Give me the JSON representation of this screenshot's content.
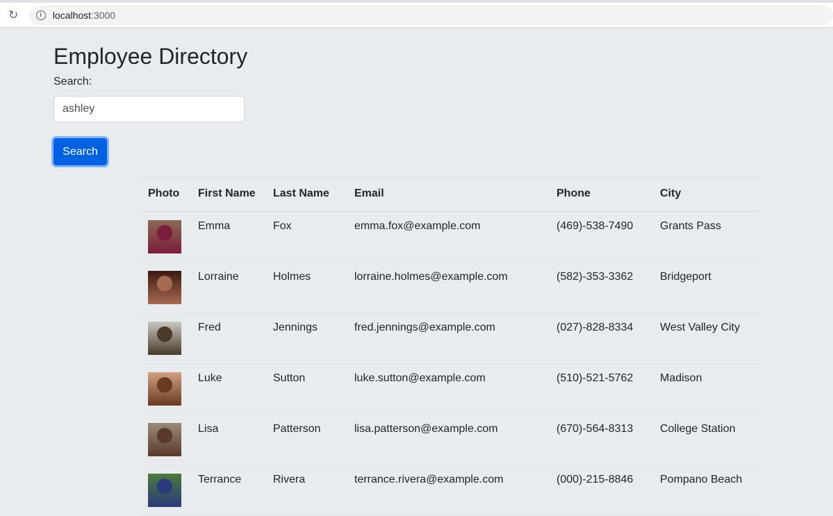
{
  "browser": {
    "host": "localhost",
    "port": ":3000"
  },
  "page": {
    "title": "Employee Directory",
    "search_label": "Search:",
    "search_value": "ashley",
    "search_button": "Search"
  },
  "table": {
    "headers": [
      "Photo",
      "First Name",
      "Last Name",
      "Email",
      "Phone",
      "City"
    ],
    "rows": [
      {
        "first": "Emma",
        "last": "Fox",
        "email": "emma.fox@example.com",
        "phone": "(469)-538-7490",
        "city": "Grants Pass",
        "photo_colors": [
          "#8a6a55",
          "#7a1d3a"
        ]
      },
      {
        "first": "Lorraine",
        "last": "Holmes",
        "email": "lorraine.holmes@example.com",
        "phone": "(582)-353-3362",
        "city": "Bridgeport",
        "photo_colors": [
          "#3a1a10",
          "#a86a50"
        ]
      },
      {
        "first": "Fred",
        "last": "Jennings",
        "email": "fred.jennings@example.com",
        "phone": "(027)-828-8334",
        "city": "West Valley City",
        "photo_colors": [
          "#c8c8c0",
          "#4a3a2a"
        ]
      },
      {
        "first": "Luke",
        "last": "Sutton",
        "email": "luke.sutton@example.com",
        "phone": "(510)-521-5762",
        "city": "Madison",
        "photo_colors": [
          "#d0a080",
          "#6a3a20"
        ]
      },
      {
        "first": "Lisa",
        "last": "Patterson",
        "email": "lisa.patterson@example.com",
        "phone": "(670)-564-8313",
        "city": "College Station",
        "photo_colors": [
          "#9a8a7a",
          "#5a3a2a"
        ]
      },
      {
        "first": "Terrance",
        "last": "Rivera",
        "email": "terrance.rivera@example.com",
        "phone": "(000)-215-8846",
        "city": "Pompano Beach",
        "photo_colors": [
          "#4a7a3a",
          "#2a3a7a"
        ]
      }
    ]
  }
}
